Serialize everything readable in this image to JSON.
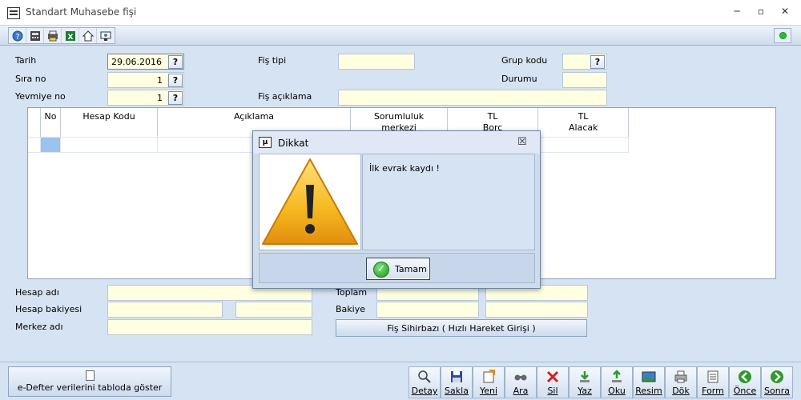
{
  "window": {
    "title": "Standart Muhasebe fişi",
    "minimize": "─",
    "restore": "▫",
    "close": "✕"
  },
  "toolbar": {
    "icons": [
      "help-icon",
      "calculator-icon",
      "print-setup-icon",
      "excel-icon",
      "home-icon",
      "screen-icon"
    ],
    "status_color": "#2bbf2b"
  },
  "form": {
    "tarih_label": "Tarih",
    "tarih_value": "29.06.2016",
    "sira_label": "Sıra no",
    "sira_value": "1",
    "yevmiye_label": "Yevmiye no",
    "yevmiye_value": "1",
    "fis_tipi_label": "Fiş tipi",
    "fis_tipi_value": "",
    "fis_aciklama_label": "Fiş açıklama",
    "fis_aciklama_value": "",
    "grup_kodu_label": "Grup kodu",
    "grup_kodu_value": "",
    "durumu_label": "Durumu",
    "durumu_value": "",
    "lookup_button": "?"
  },
  "grid": {
    "columns": [
      "No",
      "Hesap Kodu",
      "Açıklama",
      "Sorumluluk merkezi",
      "TL Borç",
      "TL Alacak"
    ]
  },
  "bottom_form": {
    "hesap_adi_label": "Hesap adı",
    "hesap_bakiyesi_label": "Hesap bakiyesi",
    "merkez_adi_label": "Merkez adı",
    "toplam_label": "Toplam",
    "bakiye_label": "Bakiye",
    "wizard_button": "Fiş Sihirbazı ( Hızlı Hareket Girişi )"
  },
  "bottom_bar": {
    "edefter_button": "e-Defter verilerini tabloda göster",
    "actions": [
      "Detay",
      "Sakla",
      "Yeni",
      "Ara",
      "Sil",
      "Yaz",
      "Oku",
      "Resim",
      "Dök",
      "Form",
      "Önce",
      "Sonra"
    ]
  },
  "dialog": {
    "title": "Dikkat",
    "logo": "μ",
    "message": "İlk evrak kaydı !",
    "ok_button": "Tamam",
    "close": "☒"
  },
  "colors": {
    "field_bg": "#ffffe1",
    "window_bg": "#d6e3f2",
    "warning_yellow": "#f5b81e"
  }
}
